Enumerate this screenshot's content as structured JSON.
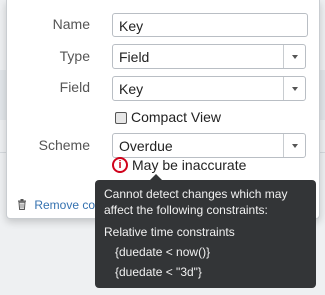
{
  "form": {
    "name_label": "Name",
    "name_value": "Key",
    "type_label": "Type",
    "type_value": "Field",
    "field_label": "Field",
    "field_value": "Key",
    "compact_view_label": "Compact View",
    "compact_view_checked": false,
    "scheme_label": "Scheme",
    "scheme_value": "Overdue"
  },
  "warning": {
    "icon": "info-icon",
    "text": "May be inaccurate"
  },
  "remove_link": {
    "icon": "trash-icon",
    "label": "Remove col"
  },
  "background": {
    "right_text": "ges"
  },
  "tooltip": {
    "line1": "Cannot detect changes which may",
    "line2": "affect the following constraints:",
    "section": "Relative time constraints",
    "constraints": [
      "{duedate < now()}",
      "{duedate < \"3d\"}"
    ]
  }
}
